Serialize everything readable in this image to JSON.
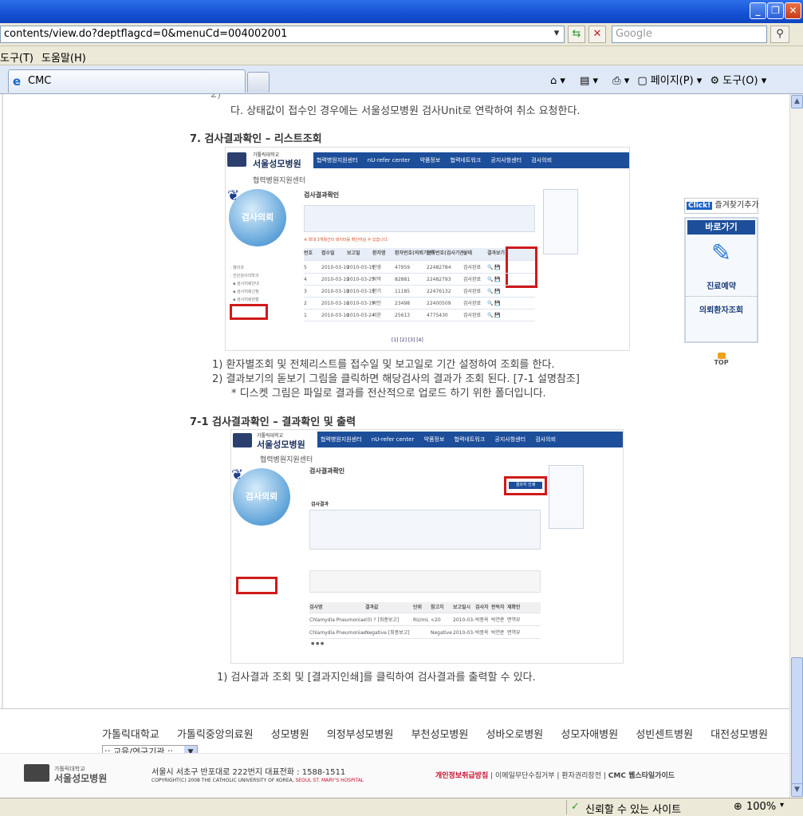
{
  "browser": {
    "address": "contents/view.do?deptflagcd=0&menuCd=004002001",
    "search_placeholder": "Google",
    "menus": [
      "도구(T)",
      "도움말(H)"
    ],
    "tab_title": "CMC",
    "commands": {
      "page": "페이지(P)",
      "tools": "도구(O)"
    },
    "status": {
      "trusted": "신뢰할 수 있는 사이트",
      "zoom": "100%"
    }
  },
  "content": {
    "intro_tail": "다. 상태값이 접수인 경우에는 서울성모병원 검사Unit로 연락하여 취소 요청한다.",
    "section7_title": "7. 검사결과확인 – 리스트조회",
    "section7_items": [
      "1)  환자별조회 및 전체리스트를 접수일 및 보고일로 기간 설정하여 조회를 한다.",
      "2)  결과보기의 돋보기 그림을 클릭하면 해당검사의 결과가 조회 된다. [7-1 설명참조]",
      "* 디스켓 그림은 파일로 결과를 전산적으로 업로드 하기 위한 폴더입니다."
    ],
    "section71_title": "7-1 검사결과확인 – 결과확인 및 출력",
    "section71_items": [
      "1)  검사결과 조회 및 [결과지인쇄]를 클릭하여 검사결과를 출력할 수 있다."
    ]
  },
  "screenshot1": {
    "univ": "가톨릭대학교",
    "hospital": "서울성모병원",
    "center": "협력병원지원센터",
    "nav": [
      "협력병원지원센터",
      "nU-refer center",
      "약품정보",
      "협력네트워크",
      "공지사항센터",
      "검사의뢰"
    ],
    "page_title": "검사결과확인",
    "circle_label": "검사의뢰",
    "notice": "※ 최대 3개월간의 데이터를 확인하실 수 있습니다.",
    "columns": [
      "번호",
      "접수일",
      "보고일",
      "환자명",
      "환자번호(의뢰기관)",
      "등록번호(검사기관)",
      "상태",
      "결과보기"
    ],
    "rows": [
      [
        "5",
        "2010-03-19",
        "2010-03-19",
        "안영",
        "47959",
        "22482784",
        "검사완료"
      ],
      [
        "4",
        "2010-03-19",
        "2010-03-25",
        "박막",
        "82881",
        "22482793",
        "검사완료"
      ],
      [
        "3",
        "2010-03-18",
        "2010-03-19",
        "한기",
        "11185",
        "22476132",
        "검사완료"
      ],
      [
        "2",
        "2010-03-16",
        "2010-03-19",
        "박인",
        "23498",
        "22400509",
        "검사완료"
      ],
      [
        "1",
        "2010-03-16",
        "2010-03-24",
        "서윤",
        "25613",
        "4775430",
        "검사완료"
      ]
    ],
    "pager": "[1] [2] [3] [4]"
  },
  "screenshot2": {
    "page_title": "검사결과확인",
    "print_button": "결과지 인쇄",
    "section": "검사결과",
    "circle_label": "검사의뢰",
    "table_cols": [
      "검사명",
      "결과값",
      "단위",
      "참고치",
      "보고일시",
      "검사자",
      "판독자",
      "재확인"
    ],
    "table_rows": [
      [
        "Chlamydia Pneumoniae Ab, IgG",
        "(0) ? [최종보고]",
        "RU/mL",
        "<20",
        "2010-03-10 16:12",
        "박종옥",
        "박연준",
        "면역부"
      ],
      [
        "Chlamydia Pneumoniae Ab, IgM",
        "Negative [최종보고]",
        "",
        "Negative",
        "2010-03-10 16:38",
        "박종옥",
        "박연준",
        "면역부"
      ]
    ]
  },
  "quick_menu": {
    "bookmark": "즐겨찾기추가",
    "click_badge": "Click!",
    "title": "바로가기",
    "items": [
      "진료예약",
      "의뢰환자조회"
    ],
    "top": "TOP"
  },
  "footer": {
    "links": [
      "가톨릭대학교",
      "가톨릭중앙의료원",
      "성모병원",
      "의정부성모병원",
      "부천성모병원",
      "성바오로병원",
      "성모자애병원",
      "성빈센트병원",
      "대전성모병원"
    ],
    "select": ":: 교육/연구기관 ::",
    "logo_univ": "가톨릭대학교",
    "logo_hosp": "서울성모병원",
    "address": "서울시 서초구 반포대로 222번지 대표전화 : 1588-1511",
    "copyright": "COPYRIGHT(C) 2008 THE CATHOLIC UNIVERSITY OF KOREA,",
    "copyright_red": "SEOUL ST. MARY'S HOSPITAL",
    "policy_links": [
      "개인정보취급방침",
      "이메일무단수집거부",
      "환자권리장전",
      "CMC 웹스타일가이드"
    ]
  },
  "colors": {
    "titlebar": "#1450d4",
    "nav_blue": "#1d4e9a",
    "highlight_red": "#d01a1a",
    "policy_red": "#c8102e"
  }
}
